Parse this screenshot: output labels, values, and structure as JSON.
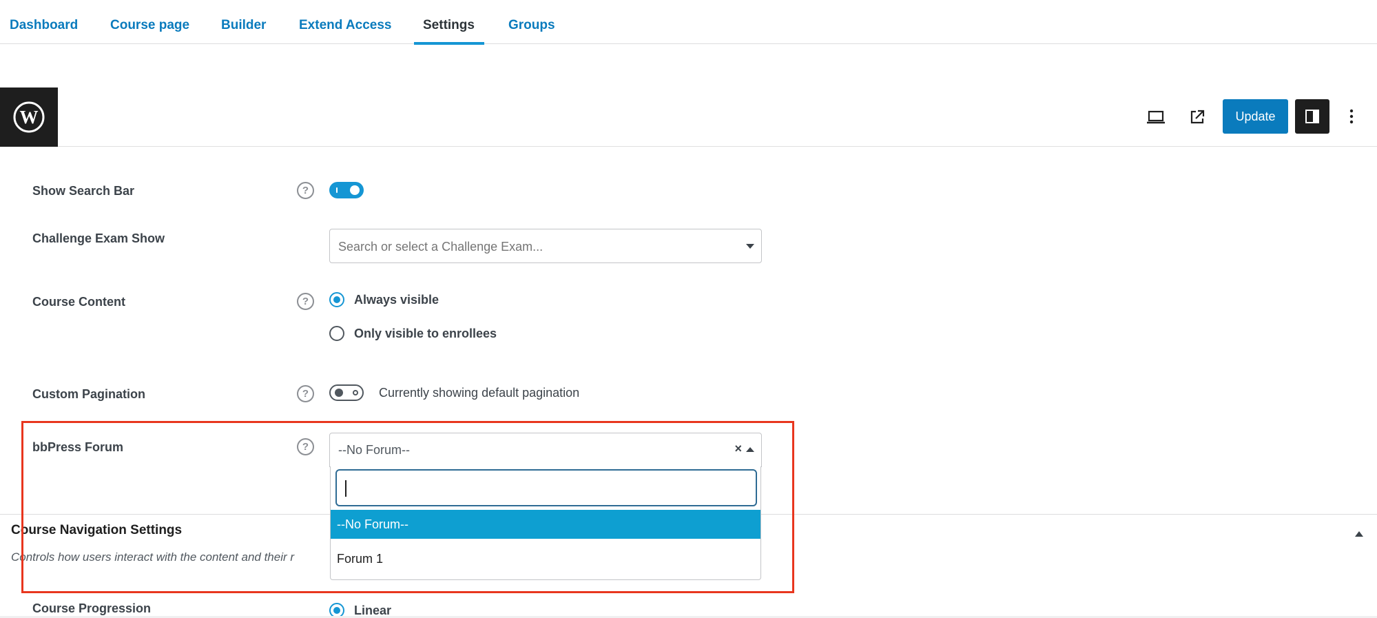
{
  "tabs": [
    {
      "label": "Dashboard",
      "active": false
    },
    {
      "label": "Course page",
      "active": false
    },
    {
      "label": "Builder",
      "active": false
    },
    {
      "label": "Extend Access",
      "active": false
    },
    {
      "label": "Settings",
      "active": true
    },
    {
      "label": "Groups",
      "active": false
    }
  ],
  "header": {
    "logo_icon": "wordpress-logo-icon",
    "update_label": "Update",
    "icons": [
      "preview-laptop-icon",
      "external-link-icon",
      "sidebar-panel-icon",
      "more-vertical-icon"
    ]
  },
  "settings": {
    "search_bar": {
      "label": "Show Search Bar",
      "enabled": true
    },
    "challenge_exam": {
      "label": "Challenge Exam Show",
      "placeholder": "Search or select a Challenge Exam..."
    },
    "course_content": {
      "label": "Course Content",
      "options": [
        "Always visible",
        "Only visible to enrollees"
      ],
      "selected": "Always visible"
    },
    "custom_pagination": {
      "label": "Custom Pagination",
      "enabled": false,
      "status_text": "Currently showing default pagination"
    },
    "bbpress_forum": {
      "label": "bbPress Forum",
      "selected": "--No Forum--",
      "clear_symbol": "×",
      "search_value": "",
      "options": [
        "--No Forum--",
        "Forum 1"
      ]
    }
  },
  "navigation": {
    "title": "Course Navigation Settings",
    "description": "Controls how users interact with the content and their r",
    "progression_label": "Course Progression",
    "progression_selected": "Linear"
  },
  "colors": {
    "accent": "#1596d4",
    "link": "#0a7bbd",
    "highlight_border": "#e8361e",
    "selected_option_bg": "#0e9fd1"
  }
}
